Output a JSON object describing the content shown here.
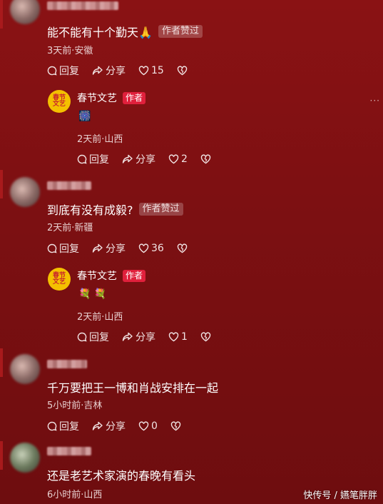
{
  "comments": [
    {
      "text": "能不能有十个勤天🙏",
      "tag": "作者赞过",
      "meta": "3天前·安徽",
      "reply_label": "回复",
      "share_label": "分享",
      "likes": "15",
      "reply": {
        "name": "春节文艺",
        "author_tag": "作者",
        "content": "🎆",
        "meta": "2天前·山西",
        "reply_label": "回复",
        "share_label": "分享",
        "likes": "2",
        "avatar_text": "春节文艺"
      }
    },
    {
      "text": "到底有没有成毅?",
      "tag": "作者赞过",
      "meta": "2天前·新疆",
      "reply_label": "回复",
      "share_label": "分享",
      "likes": "36",
      "reply": {
        "name": "春节文艺",
        "author_tag": "作者",
        "content": "💐 💐",
        "meta": "2天前·山西",
        "reply_label": "回复",
        "share_label": "分享",
        "likes": "1",
        "avatar_text": "春节文艺"
      }
    },
    {
      "text": "千万要把王一博和肖战安排在一起",
      "meta": "5小时前·吉林",
      "reply_label": "回复",
      "share_label": "分享",
      "likes": "0"
    },
    {
      "text": "还是老艺术家演的春晚有看头",
      "meta": "6小时前·山西"
    }
  ],
  "more_label": "···",
  "watermark": "快传号 / �YN笔胖胖",
  "watermark_text": "快传号 / 嬿笔胖胖",
  "colors": {
    "background": "#7d1012",
    "author_tag": "#e0203c",
    "avatar": "#f4c000"
  }
}
